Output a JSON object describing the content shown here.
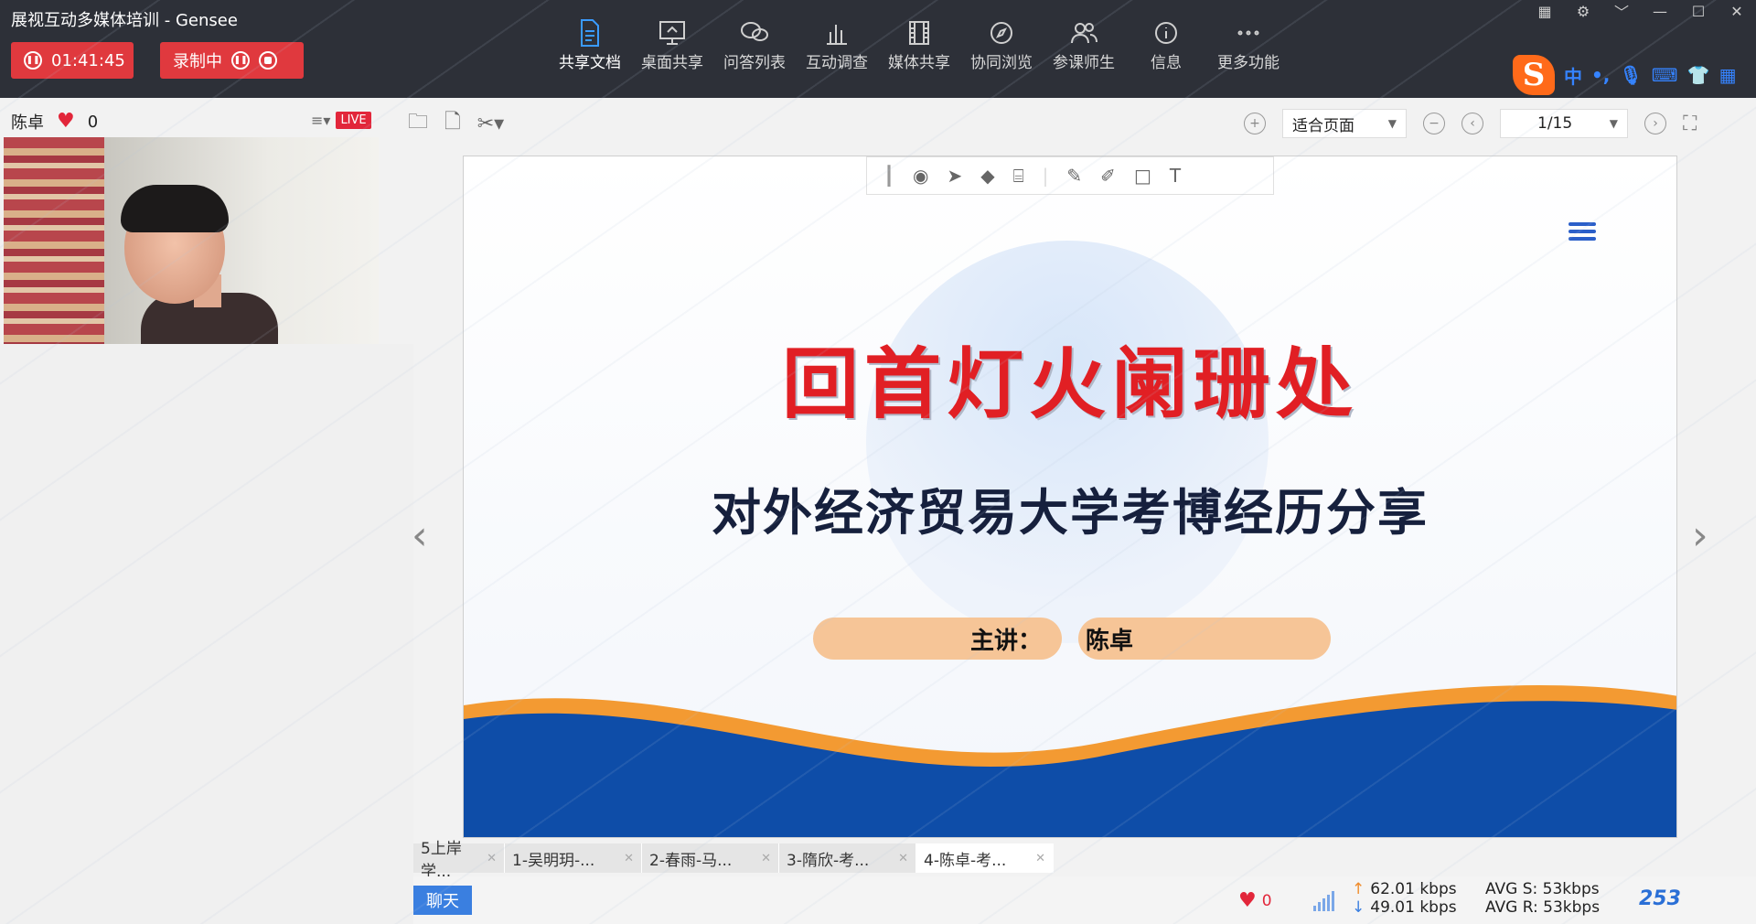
{
  "window": {
    "title": "展视互动多媒体培训  - Gensee",
    "controls": [
      "grid-icon",
      "settings-icon",
      "collapse-icon",
      "minimize-icon",
      "maximize-icon",
      "close-icon"
    ]
  },
  "session": {
    "timer": "01:41:45",
    "recording_label": "录制中"
  },
  "toolbar": {
    "items": [
      {
        "label": "共享文档",
        "icon": "document-icon",
        "active": true
      },
      {
        "label": "桌面共享",
        "icon": "desktop-share-icon",
        "active": false
      },
      {
        "label": "问答列表",
        "icon": "qa-icon",
        "active": false
      },
      {
        "label": "互动调查",
        "icon": "survey-chart-icon",
        "active": false
      },
      {
        "label": "媒体共享",
        "icon": "film-icon",
        "active": false
      },
      {
        "label": "协同浏览",
        "icon": "compass-icon",
        "active": false
      },
      {
        "label": "参课师生",
        "icon": "people-icon",
        "active": false
      },
      {
        "label": "信息",
        "icon": "info-icon",
        "active": false
      },
      {
        "label": "更多功能",
        "icon": "more-icon",
        "active": false
      }
    ]
  },
  "ime": {
    "logo": "S",
    "mode": "中",
    "punct": "•,"
  },
  "presenter": {
    "name": "陈卓",
    "likes": "0",
    "live_badge": "LIVE"
  },
  "doc_toolbar": {
    "zoom_mode": "适合页面",
    "page": "1/15"
  },
  "slide": {
    "title": "回首灯火阑珊处",
    "subtitle": "对外经济贸易大学考博经历分享",
    "speaker_label": "主讲：",
    "speaker_name": "陈卓"
  },
  "tabs": [
    {
      "label": "5上岸学...",
      "active": false
    },
    {
      "label": "1-吴明玥-...",
      "active": false
    },
    {
      "label": "2-春雨-马...",
      "active": false
    },
    {
      "label": "3-隋欣-考...",
      "active": false
    },
    {
      "label": "4-陈卓-考...",
      "active": true
    }
  ],
  "status": {
    "chat_label": "聊天",
    "likes": "0",
    "upload_rate": "62.01 kbps",
    "download_rate": "49.01 kbps",
    "avg_send": "AVG S: 53kbps",
    "avg_recv": "AVG R: 53kbps",
    "brand": "253"
  },
  "colors": {
    "accent": "#3a9bff",
    "record_red": "#e0393e",
    "title_red": "#e11f24",
    "wave_blue": "#0e4da8",
    "wave_orange": "#f39a32"
  }
}
